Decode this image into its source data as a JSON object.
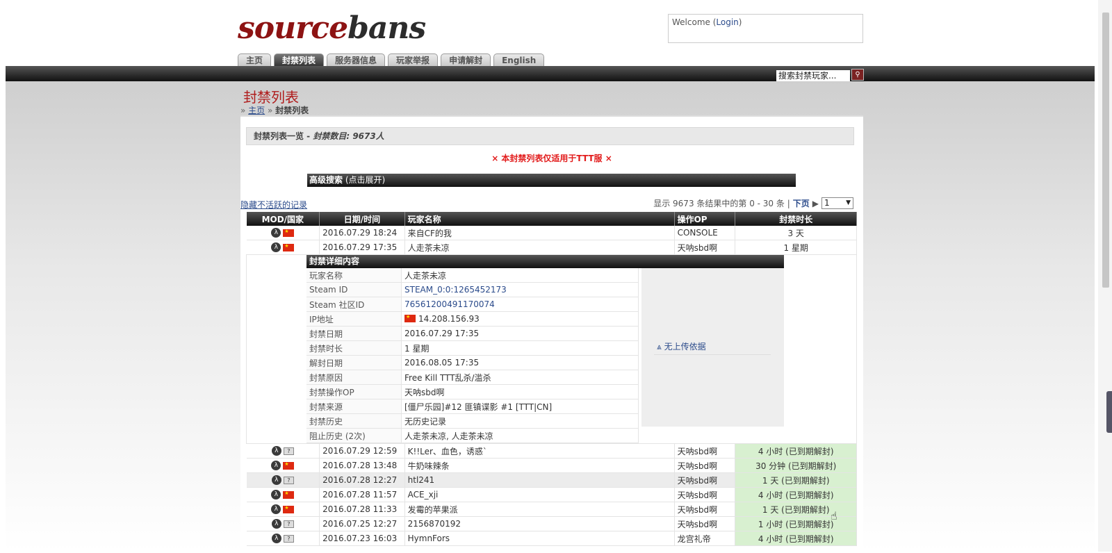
{
  "logo": {
    "part1": "source",
    "part2": "bans"
  },
  "welcome": {
    "prefix": "Welcome (",
    "link": "Login",
    "suffix": ")"
  },
  "tabs": [
    "主页",
    "封禁列表",
    "服务器信息",
    "玩家举报",
    "申请解封",
    "English"
  ],
  "search": {
    "placeholder": "搜索封禁玩家..."
  },
  "page_title": "封禁列表",
  "breadcrumb": {
    "home": "主页",
    "current": "封禁列表"
  },
  "list_header": {
    "title": "封禁列表一览 - ",
    "count": "封禁数目: 9673人"
  },
  "notice": "× 本封禁列表仅适用于TTT服 ×",
  "advanced_search": {
    "title": "高级搜索",
    "hint": " (点击展开)"
  },
  "hide_inactive": "隐藏不活跃的记录",
  "pager": {
    "text": "显示 9673 条结果中的第 0 - 30 条 |",
    "next": "下页",
    "page": "1"
  },
  "columns": [
    "MOD/国家",
    "日期/时间",
    "玩家名称",
    "操作OP",
    "封禁时长"
  ],
  "rows_top": [
    {
      "flag": "cn",
      "date": "2016.07.29 18:24",
      "name": "来自CF的我",
      "admin": "CONSOLE",
      "length": "3 天",
      "expired": false
    },
    {
      "flag": "cn",
      "date": "2016.07.29 17:35",
      "name": "人走茶未凉",
      "admin": "天呐sbd啊",
      "length": "1 星期",
      "expired": false
    }
  ],
  "detail": {
    "header": "封禁详细内容",
    "fields": [
      {
        "k": "玩家名称",
        "v": "人走茶未凉"
      },
      {
        "k": "Steam ID",
        "v": "STEAM_0:0:1265452173"
      },
      {
        "k": "Steam 社区ID",
        "v": "76561200491170074"
      },
      {
        "k": "IP地址",
        "v": "14.208.156.93"
      },
      {
        "k": "封禁日期",
        "v": "2016.07.29 17:35"
      },
      {
        "k": "封禁时长",
        "v": "1 星期"
      },
      {
        "k": "解封日期",
        "v": "2016.08.05 17:35"
      },
      {
        "k": "封禁原因",
        "v": "Free Kill TTT乱杀/滥杀"
      },
      {
        "k": "封禁操作OP",
        "v": "天呐sbd啊"
      },
      {
        "k": "封禁来源",
        "v": "[僵尸乐园]#12 匪镇谍影 #1 [TTT|CN]"
      },
      {
        "k": "封禁历史",
        "v": "无历史记录"
      },
      {
        "k": "阻止历史 (2次)",
        "v": "人走茶未凉, 人走茶未凉"
      }
    ],
    "demo": "无上传依据"
  },
  "rows_bottom": [
    {
      "flag": "unk",
      "date": "2016.07.29 12:59",
      "name": "K!!Ler、血色，诱惑`",
      "admin": "天呐sbd啊",
      "length": "4 小时 (已到期解封)"
    },
    {
      "flag": "cn",
      "date": "2016.07.28 13:48",
      "name": "牛奶味辣条",
      "admin": "天呐sbd啊",
      "length": "30 分钟 (已到期解封)"
    },
    {
      "flag": "unk",
      "date": "2016.07.28 12:27",
      "name": "htl241",
      "admin": "天呐sbd啊",
      "length": "1 天 (已到期解封)"
    },
    {
      "flag": "cn",
      "date": "2016.07.28 11:57",
      "name": "ACE_xji",
      "admin": "天呐sbd啊",
      "length": "4 小时 (已到期解封)"
    },
    {
      "flag": "cn",
      "date": "2016.07.28 11:33",
      "name": "发霉的苹果派",
      "admin": "天呐sbd啊",
      "length": "1 天 (已到期解封)"
    },
    {
      "flag": "unk",
      "date": "2016.07.25 12:27",
      "name": "2156870192",
      "admin": "天呐sbd啊",
      "length": "1 小时 (已到期解封)"
    },
    {
      "flag": "unk",
      "date": "2016.07.23 16:03",
      "name": "HymnFors",
      "admin": "龙宫礼帝",
      "length": "4 小时 (已到期解封)"
    }
  ]
}
